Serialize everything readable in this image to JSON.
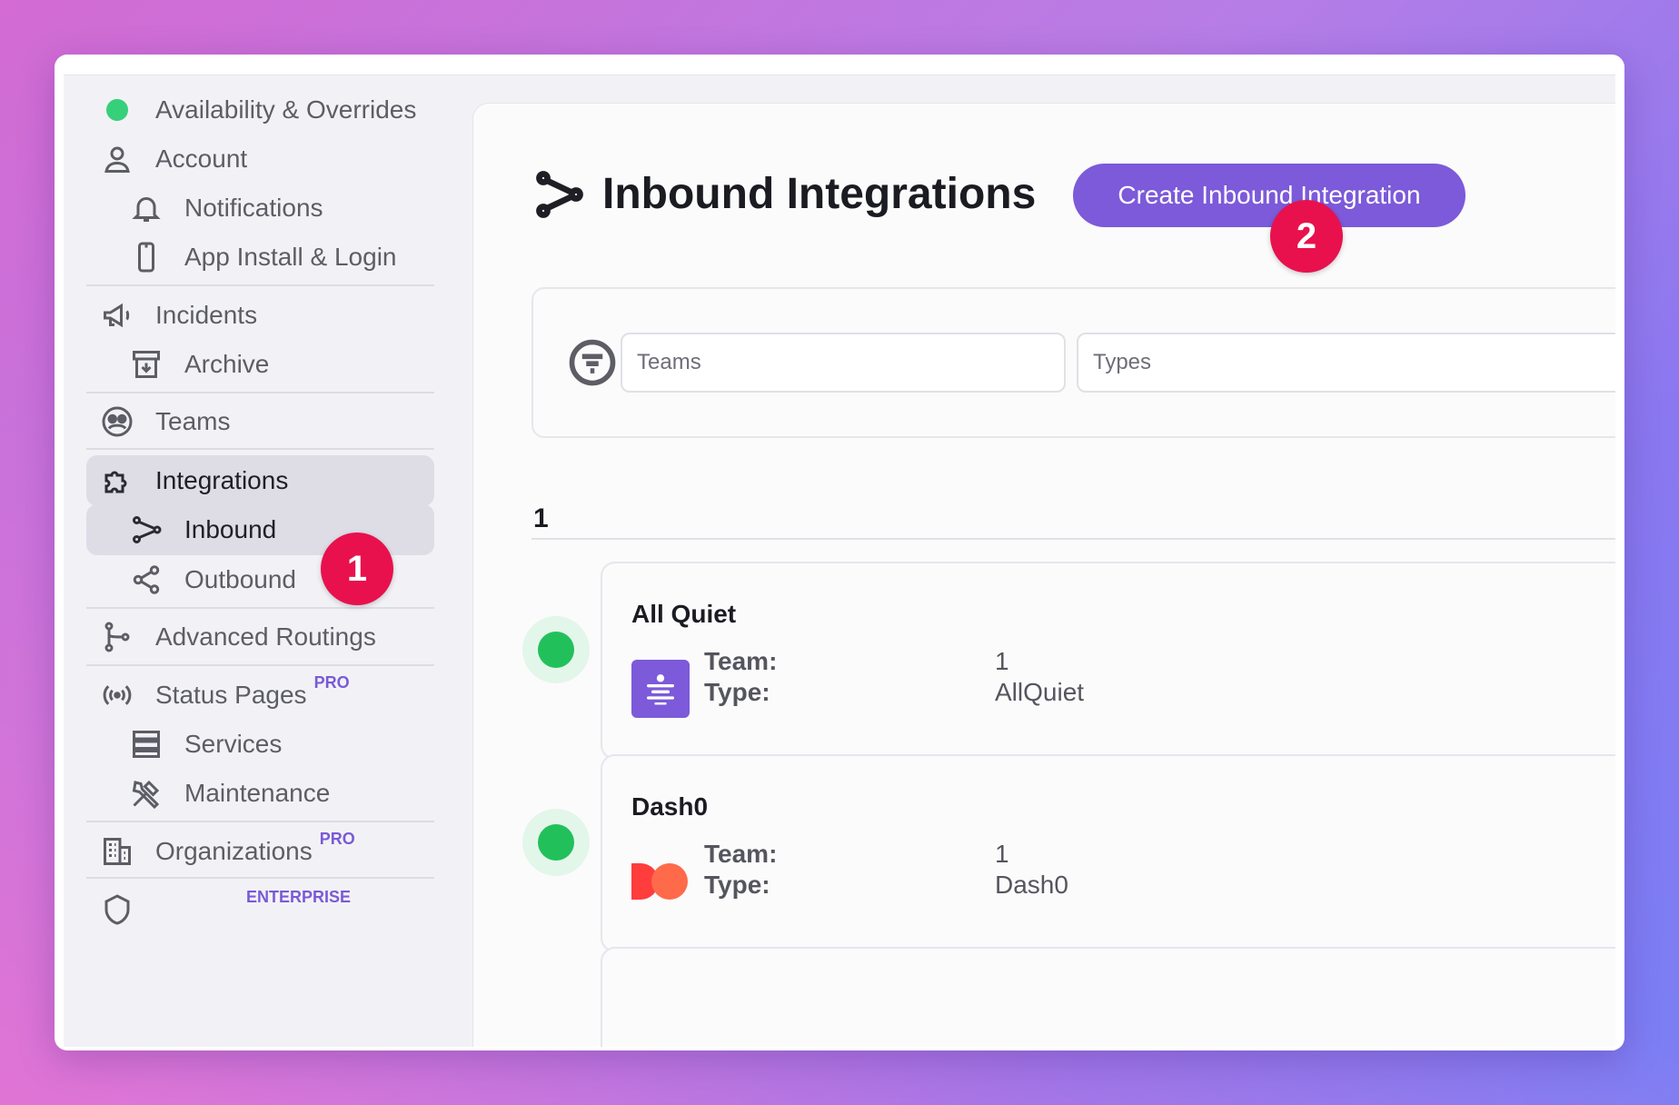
{
  "sidebar": {
    "items": [
      {
        "label": "Availability & Overrides"
      },
      {
        "label": "Account"
      },
      {
        "label": "Notifications"
      },
      {
        "label": "App Install & Login"
      },
      {
        "label": "Incidents"
      },
      {
        "label": "Archive"
      },
      {
        "label": "Teams"
      },
      {
        "label": "Integrations"
      },
      {
        "label": "Inbound"
      },
      {
        "label": "Outbound"
      },
      {
        "label": "Advanced Routings"
      },
      {
        "label": "Status Pages",
        "badge": "PRO"
      },
      {
        "label": "Services"
      },
      {
        "label": "Maintenance"
      },
      {
        "label": "Organizations",
        "badge": "PRO"
      },
      {
        "label": "",
        "badge": "ENTERPRISE"
      }
    ]
  },
  "main": {
    "title": "Inbound Integrations",
    "create_button": "Create Inbound Integration",
    "filters": {
      "teams_placeholder": "Teams",
      "types_placeholder": "Types"
    },
    "group_label": "1",
    "field_labels": {
      "team": "Team:",
      "type": "Type:"
    },
    "integrations": [
      {
        "name": "All Quiet",
        "team": "1",
        "type": "AllQuiet"
      },
      {
        "name": "Dash0",
        "team": "1",
        "type": "Dash0"
      }
    ]
  },
  "annotations": [
    "1",
    "2"
  ],
  "colors": {
    "accent": "#7c5ad9",
    "status_ok": "#22c05b",
    "marker": "#e8114d"
  }
}
